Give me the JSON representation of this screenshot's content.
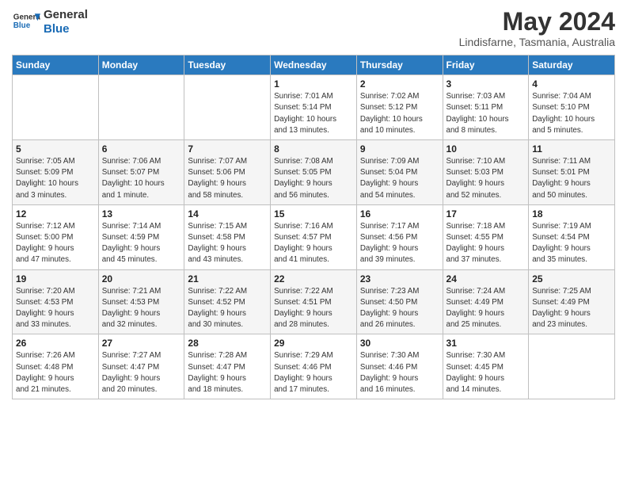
{
  "header": {
    "logo_general": "General",
    "logo_blue": "Blue",
    "month": "May 2024",
    "location": "Lindisfarne, Tasmania, Australia"
  },
  "weekdays": [
    "Sunday",
    "Monday",
    "Tuesday",
    "Wednesday",
    "Thursday",
    "Friday",
    "Saturday"
  ],
  "weeks": [
    [
      {
        "day": "",
        "info": ""
      },
      {
        "day": "",
        "info": ""
      },
      {
        "day": "",
        "info": ""
      },
      {
        "day": "1",
        "info": "Sunrise: 7:01 AM\nSunset: 5:14 PM\nDaylight: 10 hours\nand 13 minutes."
      },
      {
        "day": "2",
        "info": "Sunrise: 7:02 AM\nSunset: 5:12 PM\nDaylight: 10 hours\nand 10 minutes."
      },
      {
        "day": "3",
        "info": "Sunrise: 7:03 AM\nSunset: 5:11 PM\nDaylight: 10 hours\nand 8 minutes."
      },
      {
        "day": "4",
        "info": "Sunrise: 7:04 AM\nSunset: 5:10 PM\nDaylight: 10 hours\nand 5 minutes."
      }
    ],
    [
      {
        "day": "5",
        "info": "Sunrise: 7:05 AM\nSunset: 5:09 PM\nDaylight: 10 hours\nand 3 minutes."
      },
      {
        "day": "6",
        "info": "Sunrise: 7:06 AM\nSunset: 5:07 PM\nDaylight: 10 hours\nand 1 minute."
      },
      {
        "day": "7",
        "info": "Sunrise: 7:07 AM\nSunset: 5:06 PM\nDaylight: 9 hours\nand 58 minutes."
      },
      {
        "day": "8",
        "info": "Sunrise: 7:08 AM\nSunset: 5:05 PM\nDaylight: 9 hours\nand 56 minutes."
      },
      {
        "day": "9",
        "info": "Sunrise: 7:09 AM\nSunset: 5:04 PM\nDaylight: 9 hours\nand 54 minutes."
      },
      {
        "day": "10",
        "info": "Sunrise: 7:10 AM\nSunset: 5:03 PM\nDaylight: 9 hours\nand 52 minutes."
      },
      {
        "day": "11",
        "info": "Sunrise: 7:11 AM\nSunset: 5:01 PM\nDaylight: 9 hours\nand 50 minutes."
      }
    ],
    [
      {
        "day": "12",
        "info": "Sunrise: 7:12 AM\nSunset: 5:00 PM\nDaylight: 9 hours\nand 47 minutes."
      },
      {
        "day": "13",
        "info": "Sunrise: 7:14 AM\nSunset: 4:59 PM\nDaylight: 9 hours\nand 45 minutes."
      },
      {
        "day": "14",
        "info": "Sunrise: 7:15 AM\nSunset: 4:58 PM\nDaylight: 9 hours\nand 43 minutes."
      },
      {
        "day": "15",
        "info": "Sunrise: 7:16 AM\nSunset: 4:57 PM\nDaylight: 9 hours\nand 41 minutes."
      },
      {
        "day": "16",
        "info": "Sunrise: 7:17 AM\nSunset: 4:56 PM\nDaylight: 9 hours\nand 39 minutes."
      },
      {
        "day": "17",
        "info": "Sunrise: 7:18 AM\nSunset: 4:55 PM\nDaylight: 9 hours\nand 37 minutes."
      },
      {
        "day": "18",
        "info": "Sunrise: 7:19 AM\nSunset: 4:54 PM\nDaylight: 9 hours\nand 35 minutes."
      }
    ],
    [
      {
        "day": "19",
        "info": "Sunrise: 7:20 AM\nSunset: 4:53 PM\nDaylight: 9 hours\nand 33 minutes."
      },
      {
        "day": "20",
        "info": "Sunrise: 7:21 AM\nSunset: 4:53 PM\nDaylight: 9 hours\nand 32 minutes."
      },
      {
        "day": "21",
        "info": "Sunrise: 7:22 AM\nSunset: 4:52 PM\nDaylight: 9 hours\nand 30 minutes."
      },
      {
        "day": "22",
        "info": "Sunrise: 7:22 AM\nSunset: 4:51 PM\nDaylight: 9 hours\nand 28 minutes."
      },
      {
        "day": "23",
        "info": "Sunrise: 7:23 AM\nSunset: 4:50 PM\nDaylight: 9 hours\nand 26 minutes."
      },
      {
        "day": "24",
        "info": "Sunrise: 7:24 AM\nSunset: 4:49 PM\nDaylight: 9 hours\nand 25 minutes."
      },
      {
        "day": "25",
        "info": "Sunrise: 7:25 AM\nSunset: 4:49 PM\nDaylight: 9 hours\nand 23 minutes."
      }
    ],
    [
      {
        "day": "26",
        "info": "Sunrise: 7:26 AM\nSunset: 4:48 PM\nDaylight: 9 hours\nand 21 minutes."
      },
      {
        "day": "27",
        "info": "Sunrise: 7:27 AM\nSunset: 4:47 PM\nDaylight: 9 hours\nand 20 minutes."
      },
      {
        "day": "28",
        "info": "Sunrise: 7:28 AM\nSunset: 4:47 PM\nDaylight: 9 hours\nand 18 minutes."
      },
      {
        "day": "29",
        "info": "Sunrise: 7:29 AM\nSunset: 4:46 PM\nDaylight: 9 hours\nand 17 minutes."
      },
      {
        "day": "30",
        "info": "Sunrise: 7:30 AM\nSunset: 4:46 PM\nDaylight: 9 hours\nand 16 minutes."
      },
      {
        "day": "31",
        "info": "Sunrise: 7:30 AM\nSunset: 4:45 PM\nDaylight: 9 hours\nand 14 minutes."
      },
      {
        "day": "",
        "info": ""
      }
    ]
  ]
}
